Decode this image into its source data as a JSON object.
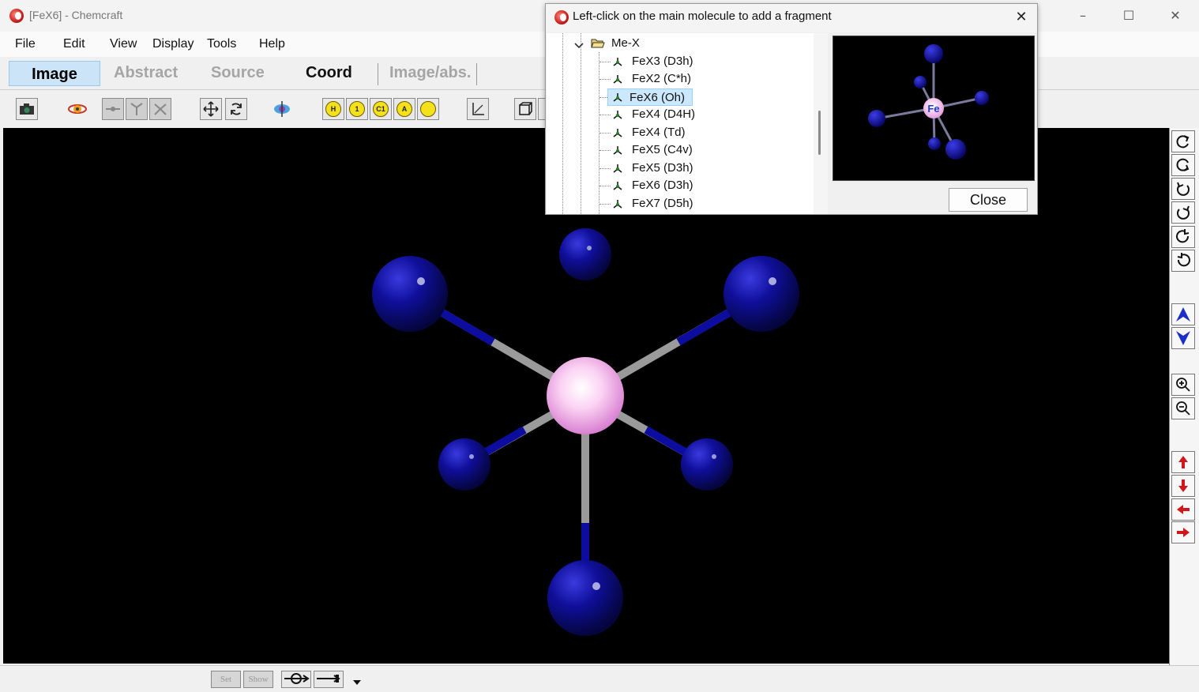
{
  "window": {
    "title": "[FeX6] - Chemcraft"
  },
  "menu": [
    "File",
    "Edit",
    "View",
    "Display",
    "Tools",
    "Help"
  ],
  "tabs": [
    "Image",
    "Abstract",
    "Source",
    "Coord",
    "Image/abs."
  ],
  "toolbar": {
    "yellow_buttons": [
      "H",
      "1",
      "C1",
      "A",
      ""
    ]
  },
  "dialog": {
    "title": "Left-click on the main molecule to add a fragment",
    "tree_root": "Me-X",
    "tree_items": [
      "FeX3 (D3h)",
      "FeX2 (C*h)",
      "FeX6 (Oh)",
      "FeX4 (D4H)",
      "FeX4 (Td)",
      "FeX5 (C4v)",
      "FeX5 (D3h)",
      "FeX6 (D3h)",
      "FeX7 (D5h)"
    ],
    "selected_index": 2,
    "preview_atom_label": "Fe",
    "close_label": "Close"
  },
  "statusbar": {
    "set_label": "Set",
    "show_label": "Show"
  },
  "colors": {
    "ligand": "#0b0b8c",
    "center": "#f0a8ea",
    "background": "#000000",
    "selection": "#cce8ff"
  }
}
